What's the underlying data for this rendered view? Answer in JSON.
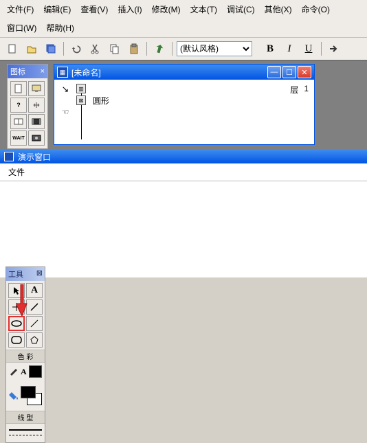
{
  "menu": {
    "file": "文件(F)",
    "edit": "编辑(E)",
    "view": "查看(V)",
    "insert": "插入(I)",
    "modify": "修改(M)",
    "text": "文本(T)",
    "debug": "调试(C)",
    "other": "其他(X)",
    "command": "命令(O)",
    "window": "窗口(W)",
    "help": "帮助(H)"
  },
  "toolbar": {
    "style_value": "(默认风格)",
    "bold": "B",
    "italic": "I",
    "underline": "U"
  },
  "icon_panel": {
    "title": "图标"
  },
  "doc": {
    "title": "[未命名]",
    "shape_label": "圆形",
    "layer_label": "层",
    "layer_num": "1"
  },
  "demo": {
    "title": "演示窗口",
    "menu_file": "文件"
  },
  "tools": {
    "title": "工具",
    "close": "⊠",
    "color_section": "色 彩",
    "line_section": "线 型"
  }
}
